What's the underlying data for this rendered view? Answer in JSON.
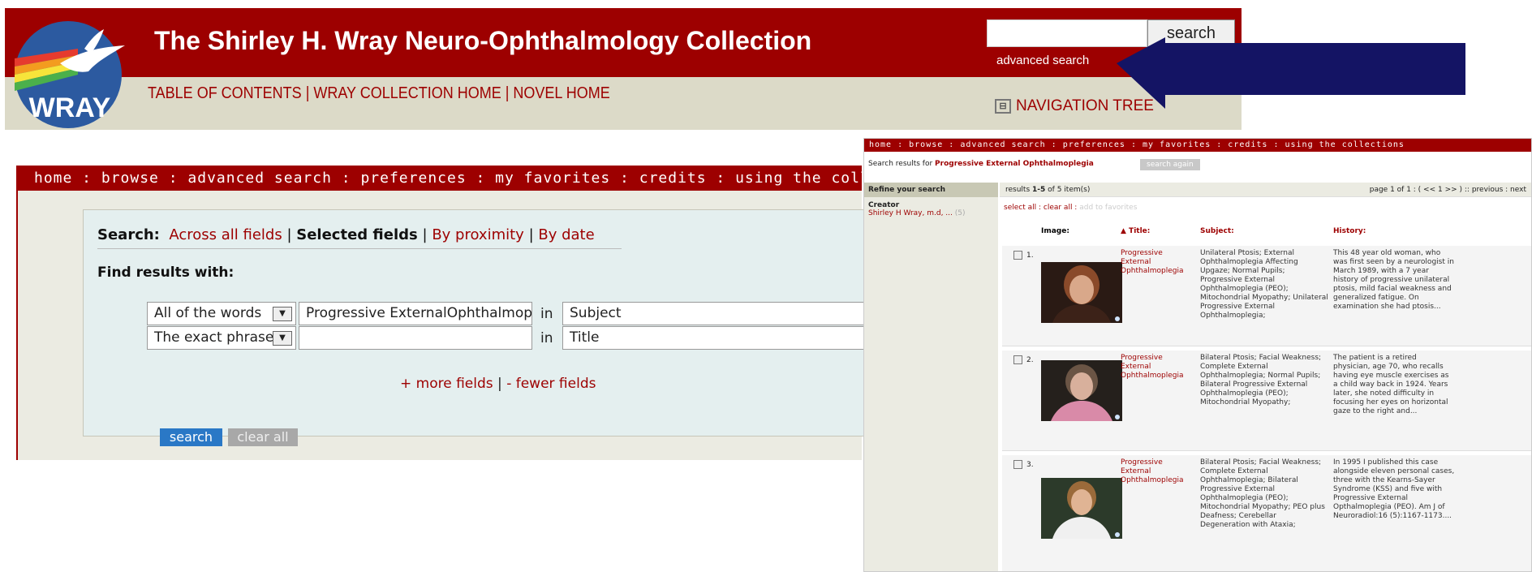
{
  "header": {
    "title": "The Shirley H. Wray Neuro-Ophthalmology Collection",
    "logo_text": "WRAY",
    "nav": [
      "TABLE OF CONTENTS",
      "WRAY COLLECTION HOME",
      "NOVEL HOME"
    ],
    "search_button": "search",
    "advanced_search": "advanced search",
    "navigation_tree": "NAVIGATION TREE"
  },
  "left_panel": {
    "nav_text": "home : browse : advanced search : preferences : my favorites : credits : using the collections",
    "search_label": "Search:",
    "modes": [
      "Across all fields",
      "Selected fields",
      "By proximity",
      "By date"
    ],
    "sep": "|",
    "find_label": "Find results with:",
    "rows": [
      {
        "match": "All of the words",
        "value": "Progressive ExternalOphthalmopleg",
        "in": "in",
        "field": "Subject"
      },
      {
        "match": "The exact phrase",
        "value": "",
        "in": "in",
        "field": "Title"
      }
    ],
    "more_fields": "+ more fields",
    "fewer_fields": "- fewer fields",
    "search_btn": "search",
    "clear_btn": "clear all"
  },
  "right_panel": {
    "nav_text": "home : browse : advanced search : preferences : my favorites : credits : using the collections",
    "results_for": "Search results for",
    "query": "Progressive External Ophthalmoplegia",
    "search_again": "search again",
    "refine": "Refine your search",
    "creator_label": "Creator",
    "creator_value": "Shirley H Wray, m.d, ...",
    "creator_count": "(5)",
    "results_prefix": "results",
    "results_range": "1-5",
    "results_suffix": "of 5 item(s)",
    "page_info": "page 1 of 1 : ( << 1 >> ) :: previous : next",
    "select_all": "select all : clear all :",
    "add_fav": "add to favorites",
    "col_image": "Image:",
    "col_title": "▲ Title:",
    "col_subject": "Subject:",
    "col_history": "History:",
    "rows": [
      {
        "num": "1.",
        "title": "Progressive External Ophthalmoplegia",
        "subject": "Unilateral Ptosis; External Ophthalmoplegia Affecting Upgaze; Normal Pupils; Progressive External Ophthalmoplegia (PEO); Mitochondrial Myopathy; Unilateral Progressive External Ophthalmoplegia;",
        "history": "This 48 year old woman, who was first seen by a neurologist in March 1989, with a 7 year history of progressive unilateral ptosis, mild facial weakness and generalized fatigue. On examination she had ptosis..."
      },
      {
        "num": "2.",
        "title": "Progressive External Ophthalmoplegia",
        "subject": "Bilateral Ptosis; Facial Weakness; Complete External Ophthalmoplegia; Normal Pupils; Bilateral Progressive External Ophthalmoplegia (PEO); Mitochondrial Myopathy;",
        "history": "The patient is a retired physician, age 70, who recalls having eye muscle exercises as a child way back in 1924. Years later, she noted difficulty in focusing her eyes on horizontal gaze to the right and..."
      },
      {
        "num": "3.",
        "title": "Progressive External Ophthalmoplegia",
        "subject": "Bilateral Ptosis; Facial Weakness; Complete External Ophthalmoplegia; Bilateral Progressive External Ophthalmoplegia (PEO); Mitochondrial Myopathy; PEO plus Deafness; Cerebellar Degeneration with Ataxia;",
        "history": "In 1995 I published this case alongside eleven personal cases, three with the Kearns-Sayer Syndrome (KSS) and five with Progressive External Opthalmoplegia (PEO). Am J of Neuroradiol:16 (5):1167-1173...."
      }
    ]
  },
  "colors": {
    "brand_red": "#9d0000",
    "banner_tan": "#dcdac8",
    "arrow": "#141464",
    "search_blue": "#2a78c6"
  }
}
